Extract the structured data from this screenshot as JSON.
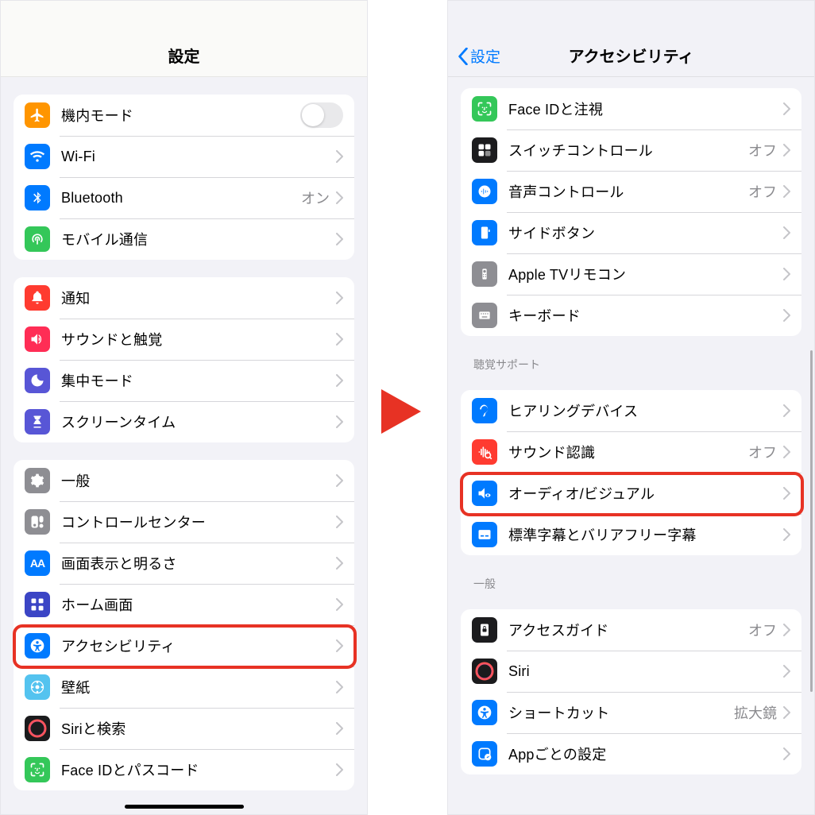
{
  "arrow_color": "#e73224",
  "left": {
    "title": "設定",
    "groups": [
      {
        "items": [
          {
            "icon": "airplane-icon",
            "bg": "#ff9500",
            "label": "機内モード",
            "type": "toggle",
            "on": false
          },
          {
            "icon": "wifi-icon",
            "bg": "#007aff",
            "label": "Wi-Fi",
            "type": "nav"
          },
          {
            "icon": "bluetooth-icon",
            "bg": "#007aff",
            "label": "Bluetooth",
            "type": "nav",
            "value": "オン"
          },
          {
            "icon": "cellular-icon",
            "bg": "#34c759",
            "label": "モバイル通信",
            "type": "nav"
          }
        ]
      },
      {
        "items": [
          {
            "icon": "notifications-icon",
            "bg": "#ff3b30",
            "label": "通知",
            "type": "nav"
          },
          {
            "icon": "sound-icon",
            "bg": "#ff2d55",
            "label": "サウンドと触覚",
            "type": "nav"
          },
          {
            "icon": "focus-icon",
            "bg": "#5856d6",
            "label": "集中モード",
            "type": "nav"
          },
          {
            "icon": "screentime-icon",
            "bg": "#5856d6",
            "label": "スクリーンタイム",
            "type": "nav"
          }
        ]
      },
      {
        "items": [
          {
            "icon": "general-icon",
            "bg": "#8e8e93",
            "label": "一般",
            "type": "nav"
          },
          {
            "icon": "controlcenter-icon",
            "bg": "#8e8e93",
            "label": "コントロールセンター",
            "type": "nav"
          },
          {
            "icon": "display-icon",
            "bg": "#007aff",
            "label": "画面表示と明るさ",
            "type": "nav"
          },
          {
            "icon": "homescreen-icon",
            "bg": "#3b45c5",
            "label": "ホーム画面",
            "type": "nav"
          },
          {
            "icon": "accessibility-icon",
            "bg": "#007aff",
            "label": "アクセシビリティ",
            "type": "nav",
            "highlighted": true
          },
          {
            "icon": "wallpaper-icon",
            "bg": "#54c3ef",
            "label": "壁紙",
            "type": "nav"
          },
          {
            "icon": "siri-icon",
            "bg": "#1b1b1d",
            "label": "Siriと検索",
            "type": "nav"
          },
          {
            "icon": "faceid-icon",
            "bg": "#34c759",
            "label": "Face IDとパスコード",
            "type": "nav"
          }
        ]
      }
    ]
  },
  "right": {
    "title": "アクセシビリティ",
    "back_label": "設定",
    "groups": [
      {
        "items": [
          {
            "icon": "faceid-icon",
            "bg": "#34c759",
            "label": "Face IDと注視",
            "type": "nav"
          },
          {
            "icon": "switchcontrol-icon",
            "bg": "#1c1c1e",
            "label": "スイッチコントロール",
            "type": "nav",
            "value": "オフ"
          },
          {
            "icon": "voicecontrol-icon",
            "bg": "#007aff",
            "label": "音声コントロール",
            "type": "nav",
            "value": "オフ"
          },
          {
            "icon": "sidebutton-icon",
            "bg": "#007aff",
            "label": "サイドボタン",
            "type": "nav"
          },
          {
            "icon": "tvremote-icon",
            "bg": "#8e8e93",
            "label": "Apple TVリモコン",
            "type": "nav"
          },
          {
            "icon": "keyboard-icon",
            "bg": "#8e8e93",
            "label": "キーボード",
            "type": "nav"
          }
        ]
      },
      {
        "header": "聴覚サポート",
        "items": [
          {
            "icon": "hearing-icon",
            "bg": "#007aff",
            "label": "ヒアリングデバイス",
            "type": "nav"
          },
          {
            "icon": "soundrecog-icon",
            "bg": "#ff3b30",
            "label": "サウンド認識",
            "type": "nav",
            "value": "オフ"
          },
          {
            "icon": "audiovisual-icon",
            "bg": "#007aff",
            "label": "オーディオ/ビジュアル",
            "type": "nav",
            "highlighted": true
          },
          {
            "icon": "subtitles-icon",
            "bg": "#007aff",
            "label": "標準字幕とバリアフリー字幕",
            "type": "nav"
          }
        ]
      },
      {
        "header": "一般",
        "items": [
          {
            "icon": "guidedaccess-icon",
            "bg": "#1c1c1e",
            "label": "アクセスガイド",
            "type": "nav",
            "value": "オフ"
          },
          {
            "icon": "siri-icon",
            "bg": "#1b1b1d",
            "label": "Siri",
            "type": "nav"
          },
          {
            "icon": "shortcut-icon",
            "bg": "#007aff",
            "label": "ショートカット",
            "type": "nav",
            "value": "拡大鏡"
          },
          {
            "icon": "perapp-icon",
            "bg": "#007aff",
            "label": "Appごとの設定",
            "type": "nav"
          }
        ]
      }
    ]
  }
}
